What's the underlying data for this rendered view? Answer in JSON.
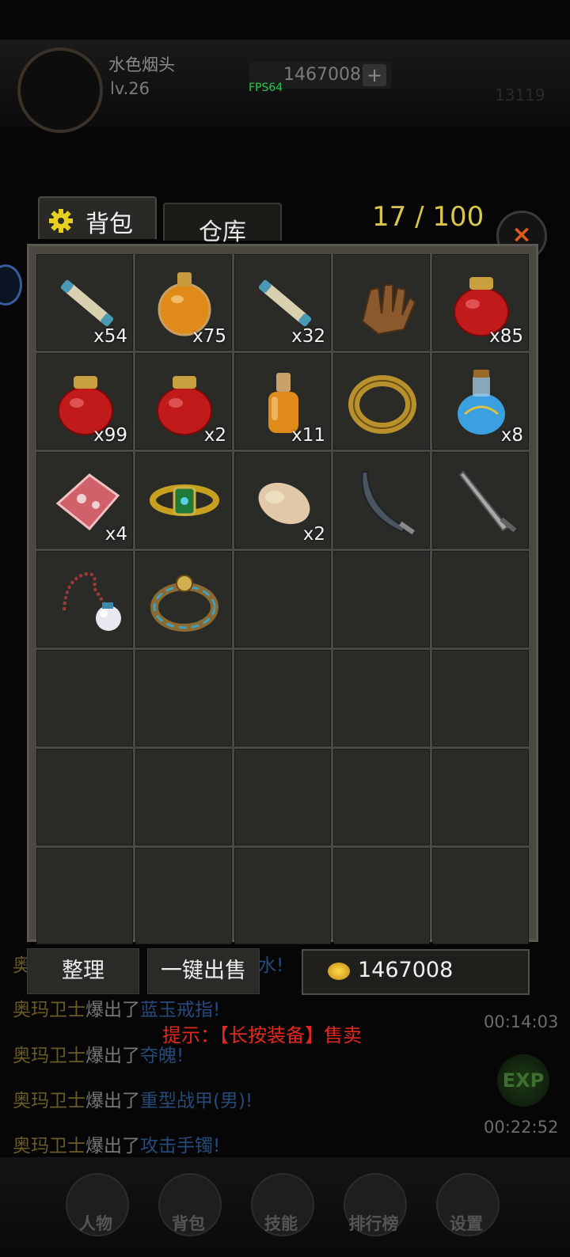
{
  "player": {
    "name": "水色烟头",
    "level": "lv.26"
  },
  "currency": {
    "gold_top": "1467008",
    "plus": "+",
    "fps": "FPS64",
    "top_right_number": "13119"
  },
  "bag": {
    "tab_bag": "背包",
    "tab_storage": "仓库",
    "capacity": "17 / 100",
    "close": "×",
    "items": [
      {
        "icon": "scroll-icon",
        "count": "x54"
      },
      {
        "icon": "orange-potion-icon",
        "count": "x75"
      },
      {
        "icon": "scroll-icon",
        "count": "x32"
      },
      {
        "icon": "gauntlet-icon",
        "count": ""
      },
      {
        "icon": "red-jar-icon",
        "count": "x85"
      },
      {
        "icon": "red-jar-icon",
        "count": "x99"
      },
      {
        "icon": "red-jar-icon",
        "count": "x2"
      },
      {
        "icon": "small-potion-icon",
        "count": "x11"
      },
      {
        "icon": "ring-icon",
        "count": ""
      },
      {
        "icon": "blue-potion-icon",
        "count": "x8"
      },
      {
        "icon": "meat-icon",
        "count": "x4"
      },
      {
        "icon": "bracelet-icon",
        "count": ""
      },
      {
        "icon": "roast-chicken-icon",
        "count": "x2"
      },
      {
        "icon": "curved-blade-icon",
        "count": ""
      },
      {
        "icon": "sword-icon",
        "count": ""
      },
      {
        "icon": "pearl-necklace-icon",
        "count": ""
      },
      {
        "icon": "jeweled-ring-icon",
        "count": ""
      }
    ],
    "sort_label": "整理",
    "sell_all_label": "一键出售",
    "gold": "1467008",
    "hint": "提示：【长按装备】售卖"
  },
  "chat": [
    {
      "who": "奥",
      "mid": "",
      "loot": "水!"
    },
    {
      "who": "奥玛卫士",
      "mid": "爆出了",
      "loot": "蓝玉戒指!"
    },
    {
      "who": "奥玛卫士",
      "mid": "爆出了",
      "loot": "夺魄!"
    },
    {
      "who": "奥玛卫士",
      "mid": "爆出了",
      "loot": "重型战甲(男)!"
    },
    {
      "who": "奥玛卫士",
      "mid": "爆出了",
      "loot": "攻击手镯!"
    }
  ],
  "timers": [
    "00:14:03",
    "00:22:52"
  ],
  "exp_badge": "EXP",
  "nav": [
    "人物",
    "背包",
    "技能",
    "排行榜",
    "设置"
  ],
  "colors": {
    "capacity": "#d8c74c",
    "hint": "#e0281e",
    "close": "#e45a1c",
    "fps": "#27c94d"
  }
}
